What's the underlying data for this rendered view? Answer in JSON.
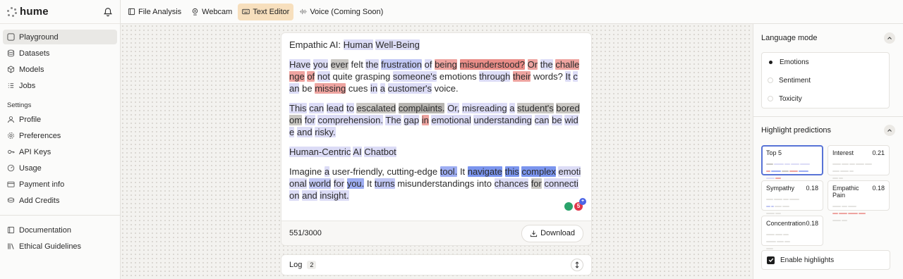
{
  "app": {
    "logo_text": "hume"
  },
  "sidebar": {
    "items": [
      {
        "label": "Playground",
        "icon": "square-icon",
        "active": true
      },
      {
        "label": "Datasets",
        "icon": "database-icon"
      },
      {
        "label": "Models",
        "icon": "cube-icon"
      },
      {
        "label": "Jobs",
        "icon": "list-icon"
      }
    ],
    "settings_label": "Settings",
    "settings_items": [
      {
        "label": "Profile",
        "icon": "user-icon"
      },
      {
        "label": "Preferences",
        "icon": "gear-icon"
      },
      {
        "label": "API Keys",
        "icon": "key-icon"
      },
      {
        "label": "Usage",
        "icon": "gauge-icon"
      },
      {
        "label": "Payment info",
        "icon": "card-icon"
      },
      {
        "label": "Add Credits",
        "icon": "coins-icon"
      }
    ],
    "footer_items": [
      {
        "label": "Documentation",
        "icon": "book-icon"
      },
      {
        "label": "Ethical Guidelines",
        "icon": "library-icon"
      }
    ]
  },
  "tabs": [
    {
      "label": "File Analysis",
      "icon": "file-icon"
    },
    {
      "label": "Webcam",
      "icon": "webcam-icon"
    },
    {
      "label": "Text Editor",
      "icon": "keyboard-icon",
      "active": true
    },
    {
      "label": "Voice (Coming Soon)",
      "icon": "waveform-icon"
    }
  ],
  "editor": {
    "title": "Empathic AI: Human Well-Being",
    "para1": "Have you ever felt the frustration of being misunderstood? Or the challenge of not quite grasping someone's emotions through their words? It can be missing cues in a customer's voice.",
    "para2": "This can lead to escalated complaints. Or, misreading a student's boredom for comprehension. The gap in emotional understanding can be wide and risky.",
    "heading2": "Human-Centric AI Chatbot",
    "para3": "Imagine a user-friendly, cutting-edge tool. It navigate this complex emotional world for you. It turns misunderstandings into chances for connection and insight.",
    "badge_count": "5",
    "char_count": "551/3000",
    "download_label": "Download"
  },
  "log": {
    "label": "Log",
    "count": "2"
  },
  "right_panel": {
    "language_mode_title": "Language mode",
    "modes": [
      {
        "label": "Emotions",
        "selected": true
      },
      {
        "label": "Sentiment",
        "selected": false
      },
      {
        "label": "Toxicity",
        "selected": false
      }
    ],
    "highlight_title": "Highlight predictions",
    "predictions": [
      {
        "label": "Top 5",
        "score": "",
        "selected": true
      },
      {
        "label": "Interest",
        "score": "0.21"
      },
      {
        "label": "Sympathy",
        "score": "0.18"
      },
      {
        "label": "Empathic Pain",
        "score": "0.18"
      },
      {
        "label": "Concentration",
        "score": "0.18"
      }
    ],
    "enable_label": "Enable highlights",
    "enable_checked": true
  },
  "colors": {
    "active_tab": "#f7dfbd",
    "selected_border": "#5873d6",
    "highlight_red": "#eea4a0",
    "highlight_blue": "#9eaef3",
    "highlight_grey": "#c9c7c3",
    "highlight_lavender": "#dcdcf6"
  }
}
